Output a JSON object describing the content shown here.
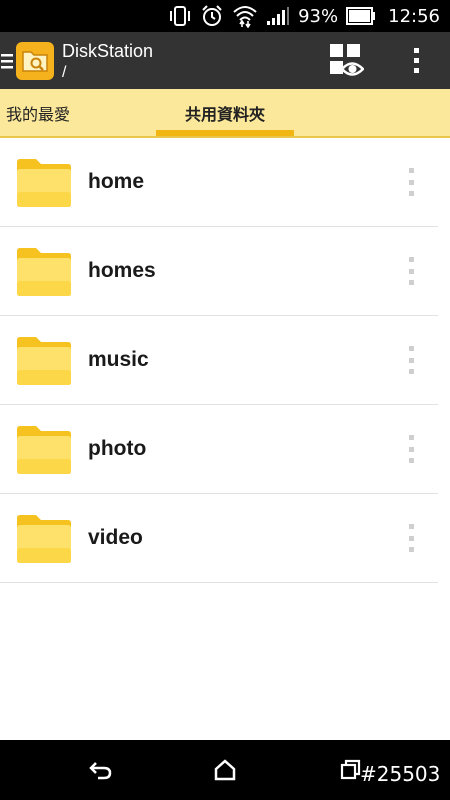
{
  "status_bar": {
    "battery_percent": "93%",
    "time": "12:56",
    "icons": [
      "vibrate-icon",
      "alarm-icon",
      "wifi-icon",
      "signal-icon",
      "battery-icon"
    ]
  },
  "app_bar": {
    "title": "DiskStation",
    "path": "/",
    "icons": [
      "menu-icon",
      "app-logo-icon",
      "view-mode-icon",
      "overflow-menu-icon"
    ]
  },
  "tabs": [
    {
      "label": "我的最愛",
      "selected": false
    },
    {
      "label": "共用資料夾",
      "selected": true
    }
  ],
  "folders": [
    {
      "name": "home"
    },
    {
      "name": "homes"
    },
    {
      "name": "music"
    },
    {
      "name": "photo"
    },
    {
      "name": "video"
    }
  ],
  "nav_bar": {
    "icons": [
      "back-icon",
      "home-icon",
      "recents-icon"
    ],
    "watermark": "#25503"
  },
  "colors": {
    "app_bar": "#333333",
    "tab_bar": "#fbe89a",
    "tab_indicator": "#f2b613",
    "folder_yellow": "#f7cf2c",
    "accent": "#f5b21c"
  }
}
